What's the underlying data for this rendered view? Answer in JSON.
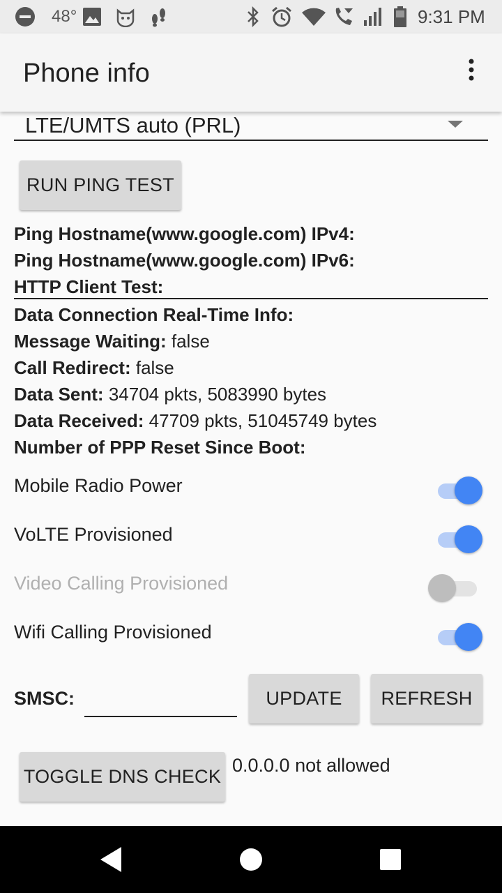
{
  "status_bar": {
    "temperature": "48°",
    "time": "9:31 PM",
    "icons": [
      "do-not-disturb-icon",
      "image-icon",
      "cat-icon",
      "footprints-icon",
      "bluetooth-icon",
      "alarm-icon",
      "wifi-icon",
      "wifi-calling-icon",
      "signal-icon",
      "battery-icon"
    ]
  },
  "app_bar": {
    "title": "Phone info",
    "overflow_icon": "more-vert-icon"
  },
  "network_type": {
    "selected": "LTE/UMTS auto (PRL)"
  },
  "ping": {
    "button_label": "RUN PING TEST",
    "ipv4_label": "Ping Hostname(www.google.com) IPv4:",
    "ipv6_label": "Ping Hostname(www.google.com) IPv6:",
    "http_label": "HTTP Client Test:"
  },
  "info": {
    "data_connection_label": "Data Connection Real-Time Info:",
    "message_waiting_label": "Message Waiting:",
    "message_waiting_value": "false",
    "call_redirect_label": "Call Redirect:",
    "call_redirect_value": "false",
    "data_sent_label": "Data Sent:",
    "data_sent_value": "34704 pkts, 5083990 bytes",
    "data_received_label": "Data Received:",
    "data_received_value": "47709 pkts, 51045749 bytes",
    "ppp_reset_label": "Number of PPP Reset Since Boot:"
  },
  "switches": [
    {
      "label": "Mobile Radio Power",
      "on": true,
      "enabled": true
    },
    {
      "label": "VoLTE Provisioned",
      "on": true,
      "enabled": true
    },
    {
      "label": "Video Calling Provisioned",
      "on": false,
      "enabled": false
    },
    {
      "label": "Wifi Calling Provisioned",
      "on": true,
      "enabled": true
    }
  ],
  "smsc": {
    "label": "SMSC:",
    "value": "",
    "update_label": "UPDATE",
    "refresh_label": "REFRESH"
  },
  "dns": {
    "button_label": "TOGGLE DNS CHECK",
    "status": "0.0.0.0 not allowed"
  },
  "nav_bar": {
    "icons": [
      "back-icon",
      "home-icon",
      "recents-icon"
    ]
  },
  "colors": {
    "accent": "#4285f4",
    "accent_track": "#b6cdf7",
    "button_bg": "#d9d9d9",
    "disabled_text": "#b0b0b0"
  }
}
